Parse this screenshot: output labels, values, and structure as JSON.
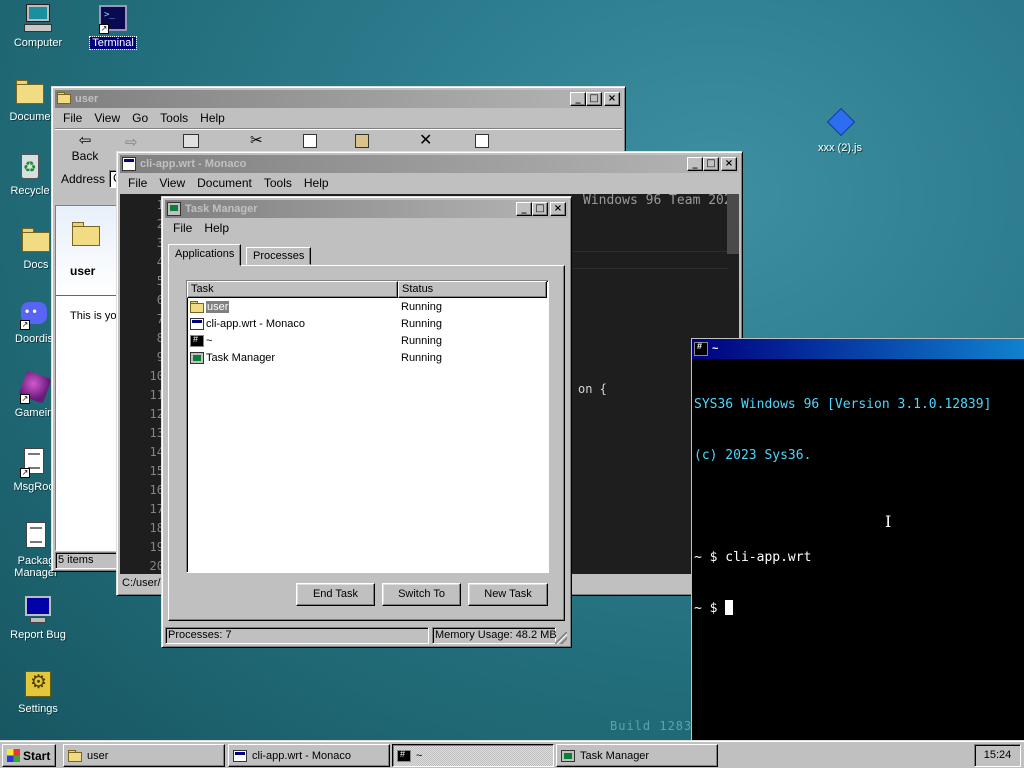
{
  "desktop": {
    "icons": [
      {
        "label": "Computer",
        "icon": "computer-icon"
      },
      {
        "label": "Terminal",
        "icon": "terminal-icon"
      },
      {
        "label": "Docume",
        "icon": "folder-icon"
      },
      {
        "label": "Recycle",
        "icon": "recycle-bin-icon"
      },
      {
        "label": "Docs",
        "icon": "folder-icon"
      },
      {
        "label": "Doordis",
        "icon": "discord-icon"
      },
      {
        "label": "Gamein",
        "icon": "game-icon"
      },
      {
        "label": "MsgRoo",
        "icon": "message-room-icon"
      },
      {
        "label": "Packag Manager",
        "icon": "package-manager-icon"
      },
      {
        "label": "Report Bug",
        "icon": "report-bug-icon"
      },
      {
        "label": "Settings",
        "icon": "settings-icon"
      },
      {
        "label": "xxx (2).js",
        "icon": "js-file-icon"
      }
    ],
    "watermark": "Build 1283"
  },
  "explorer": {
    "title": "user",
    "menu": [
      "File",
      "View",
      "Go",
      "Tools",
      "Help"
    ],
    "toolbar": {
      "back": "Back"
    },
    "address_label": "Address",
    "address_value": "C",
    "folder_name": "user",
    "description": "This is you",
    "status": "5 items"
  },
  "monaco": {
    "title": "cli-app.wrt - Monaco",
    "menu": [
      "File",
      "View",
      "Document",
      "Tools",
      "Help"
    ],
    "line_numbers": [
      "1",
      "2",
      "3",
      "4",
      "5",
      "6",
      "7",
      "8",
      "9",
      "10",
      "11",
      "12",
      "13",
      "14",
      "15",
      "16",
      "17",
      "18",
      "19",
      "20"
    ],
    "code_fragment_1": "Windows 96 Team 202",
    "code_fragment_2": "on {",
    "status_path": "C:/user/"
  },
  "task_manager": {
    "title": "Task Manager",
    "menu": [
      "File",
      "Help"
    ],
    "tabs": [
      "Applications",
      "Processes"
    ],
    "active_tab": "Applications",
    "columns": [
      "Task",
      "Status"
    ],
    "rows": [
      {
        "task": "user",
        "status": "Running",
        "icon": "folder-icon"
      },
      {
        "task": "cli-app.wrt - Monaco",
        "status": "Running",
        "icon": "app-icon"
      },
      {
        "task": "~",
        "status": "Running",
        "icon": "terminal-icon"
      },
      {
        "task": "Task Manager",
        "status": "Running",
        "icon": "task-manager-icon"
      }
    ],
    "buttons": {
      "end_task": "End Task",
      "switch_to": "Switch To",
      "new_task": "New Task"
    },
    "status_processes": "Processes: 7",
    "status_memory": "Memory Usage: 48.2 MB"
  },
  "terminal": {
    "title": "~",
    "lines": [
      "SYS36 Windows 96 [Version 3.1.0.12839]",
      "(c) 2023 Sys36.",
      "",
      "~ $ cli-app.wrt",
      "~ $ "
    ]
  },
  "taskbar": {
    "start": "Start",
    "items": [
      {
        "label": "user",
        "icon": "folder-icon"
      },
      {
        "label": "cli-app.wrt - Monaco",
        "icon": "app-icon"
      },
      {
        "label": "~",
        "icon": "terminal-icon"
      },
      {
        "label": "Task Manager",
        "icon": "task-manager-icon"
      }
    ],
    "clock": "15:24"
  },
  "colors": {
    "desktop": "#2b7b8d",
    "title_active": "#000080",
    "title_inactive": "#808080",
    "terminal_text": "#4fd6ff"
  }
}
